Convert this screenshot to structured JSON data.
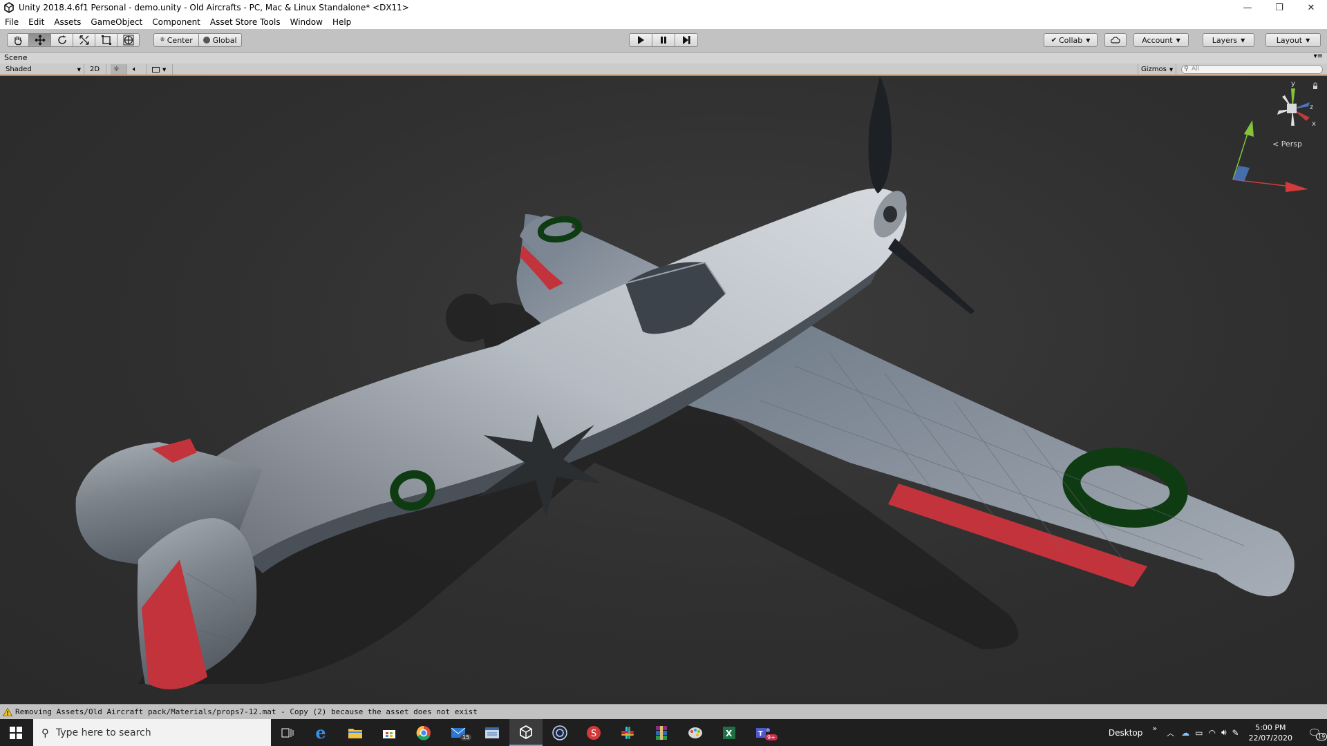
{
  "window": {
    "title": "Unity 2018.4.6f1 Personal - demo.unity - Old Aircrafts - PC, Mac & Linux Standalone* <DX11>",
    "controls": {
      "minimize": "—",
      "restore": "❐",
      "close": "✕"
    }
  },
  "menu": {
    "items": [
      "File",
      "Edit",
      "Assets",
      "GameObject",
      "Component",
      "Asset Store Tools",
      "Window",
      "Help"
    ]
  },
  "toolbar": {
    "tools": [
      "hand-icon",
      "move-icon",
      "rotate-icon",
      "scale-icon",
      "rect-icon",
      "transform-icon"
    ],
    "pivot_mode": "Center",
    "pivot_rotation": "Global",
    "collab_label": "Collab",
    "account_label": "Account",
    "layers_label": "Layers",
    "layout_label": "Layout"
  },
  "scene": {
    "tab_label": "Scene",
    "shading_mode": "Shaded",
    "mode_2d": "2D",
    "gizmos_label": "Gizmos",
    "search_placeholder": "All",
    "projection_label": "Persp",
    "gizmo_axes": {
      "y": "y",
      "z": "z",
      "x": "x"
    }
  },
  "status": {
    "message": "Removing Assets/Old Aircraft pack/Materials/props7-12.mat - Copy (2) because the asset does not exist"
  },
  "taskbar": {
    "search_placeholder": "Type here to search",
    "mail_badge": "15",
    "teams_badge": "9+",
    "desktop_label": "Desktop",
    "chevron": "»",
    "time": "5:00 PM",
    "date": "22/07/2020",
    "notification_count": "19"
  },
  "colors": {
    "accent_orange": "#e07a30",
    "toolbar_gray": "#c2c2c2",
    "viewport_bg": "#2f2f2f",
    "roundel_green": "#0f3b12",
    "wing_red": "#c3333c"
  }
}
